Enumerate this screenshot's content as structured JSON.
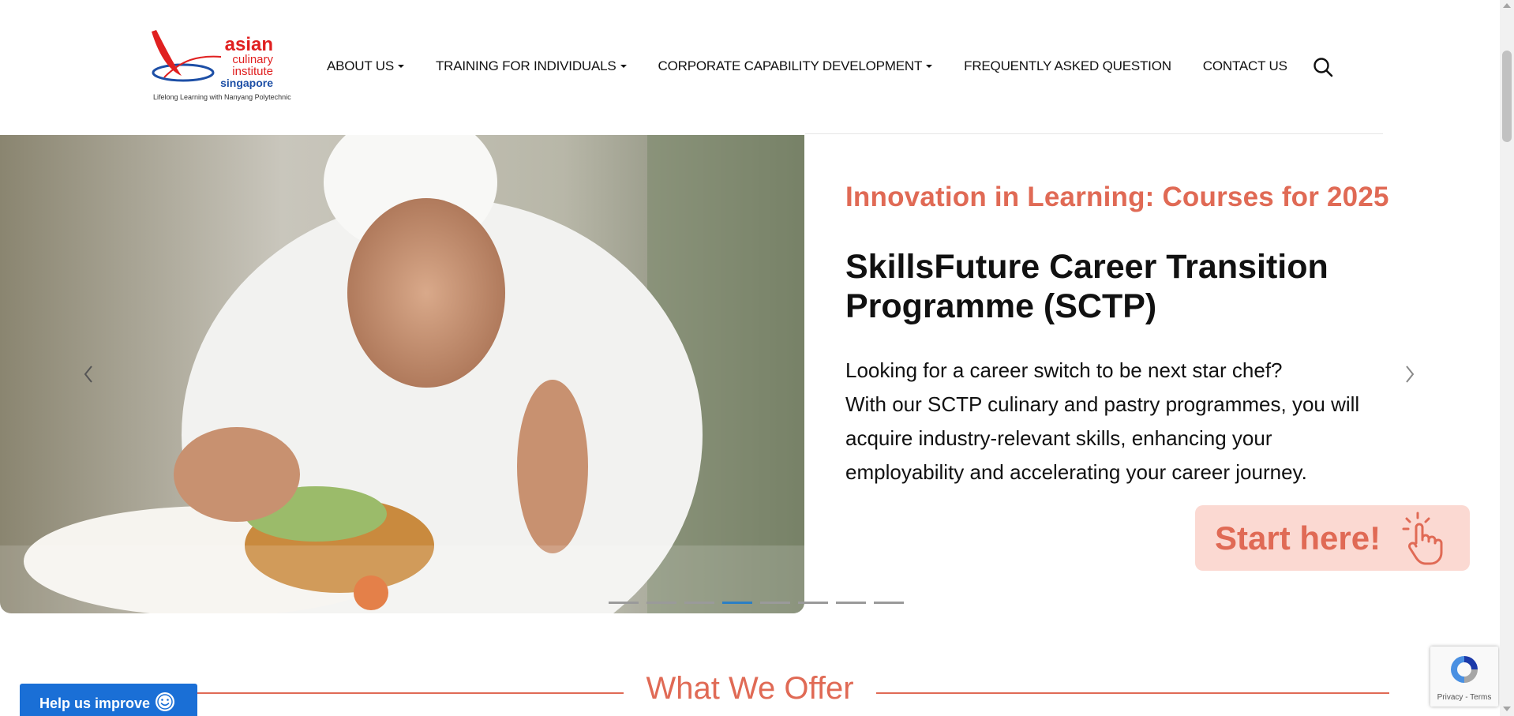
{
  "brand": {
    "line1": "asian",
    "line2": "culinary",
    "line3": "institute",
    "line4": "singapore",
    "tagline": "Lifelong Learning with Nanyang Polytechnic",
    "red": "#e02020",
    "blue": "#1d4fa6"
  },
  "nav": {
    "items": [
      {
        "label": "ABOUT US",
        "dropdown": true
      },
      {
        "label": "TRAINING FOR INDIVIDUALS",
        "dropdown": true
      },
      {
        "label": "CORPORATE CAPABILITY DEVELOPMENT",
        "dropdown": true
      },
      {
        "label": "FREQUENTLY ASKED QUESTION",
        "dropdown": false
      },
      {
        "label": "CONTACT US",
        "dropdown": false
      }
    ],
    "search_icon": "search-icon"
  },
  "hero": {
    "kicker": "Innovation in Learning: Courses for 2025",
    "title": "SkillsFuture Career Transition Programme (SCTP)",
    "body": [
      "Looking for a career switch to be next star chef?",
      "With our SCTP culinary and pastry programmes, you will",
      "acquire industry-relevant skills, enhancing your",
      "employability and accelerating your career journey."
    ],
    "cta_label": "Start here!",
    "cta_icon": "pointing-hand-icon",
    "slides_total": 8,
    "active_slide": 4,
    "accent": "#e06a55"
  },
  "section": {
    "title": "What We Offer"
  },
  "widgets": {
    "help_label": "Help us improve",
    "help_color": "#1a6fd6",
    "recaptcha_text": "Privacy - Terms"
  }
}
